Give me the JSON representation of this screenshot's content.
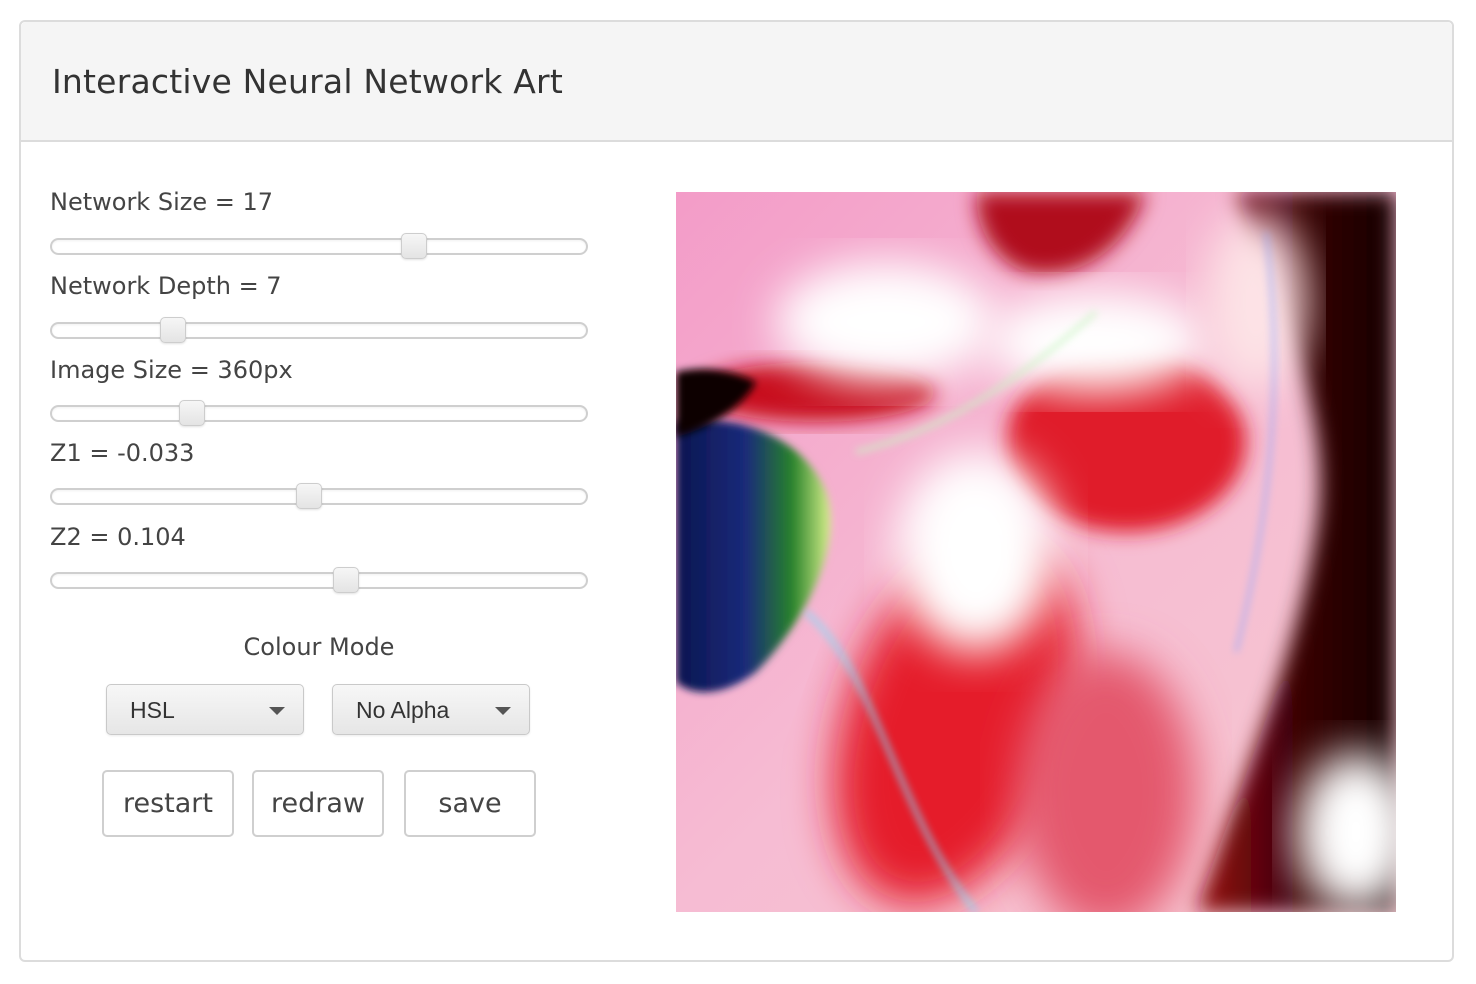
{
  "header": {
    "title": "Interactive Neural Network Art"
  },
  "controls": {
    "network_size": {
      "label": "Network Size = 17",
      "value": 17
    },
    "network_depth": {
      "label": "Network Depth = 7",
      "value": 7
    },
    "image_size": {
      "label": "Image Size = 360px",
      "value": 360
    },
    "z1": {
      "label": "Z1 = -0.033",
      "value": -0.033
    },
    "z2": {
      "label": "Z2 = 0.104",
      "value": 0.104
    }
  },
  "colour_mode": {
    "label": "Colour Mode",
    "mode_selected": "HSL",
    "alpha_selected": "No Alpha"
  },
  "buttons": {
    "restart": "restart",
    "redraw": "redraw",
    "save": "save"
  },
  "artwork": {
    "palette": [
      "#f0a6c8",
      "#e8222e",
      "#ffffff",
      "#1a0305",
      "#0b1a5a",
      "#1f8a1a"
    ]
  }
}
